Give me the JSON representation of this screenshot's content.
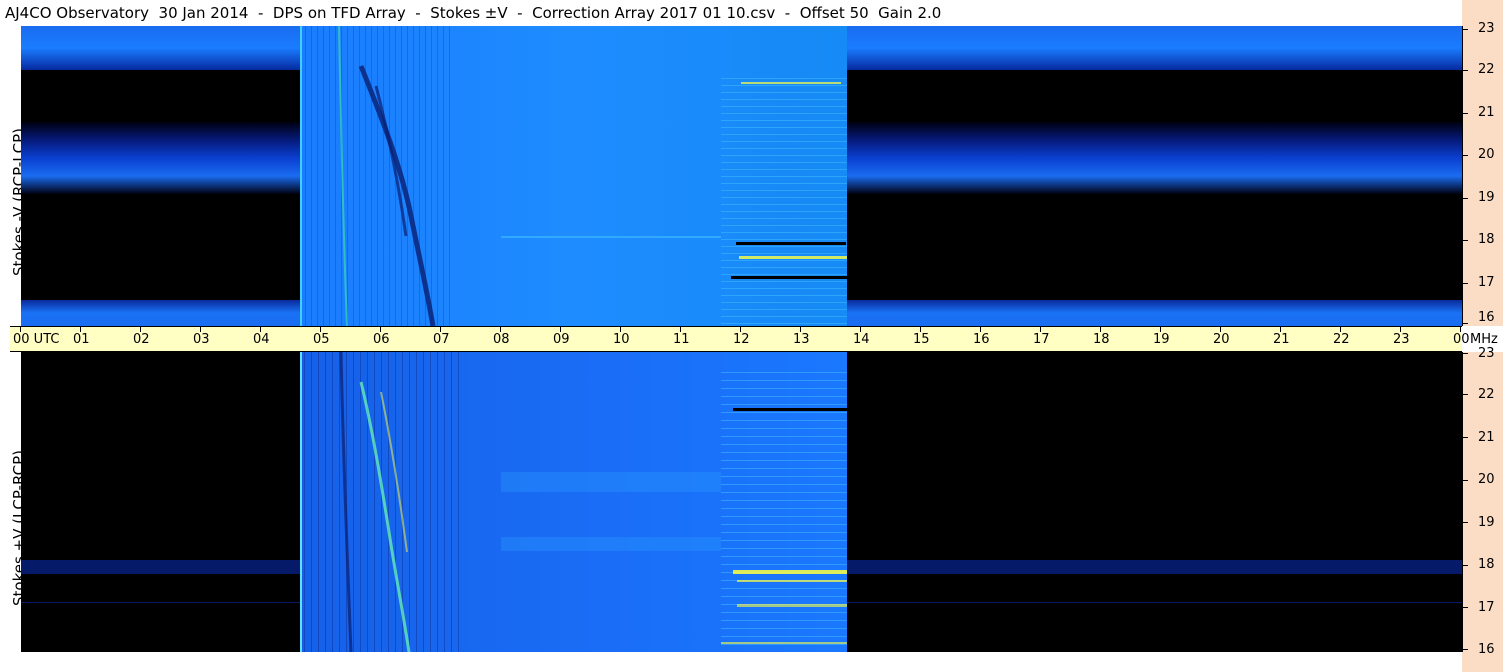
{
  "title": "AJ4CO Observatory  30 Jan 2014  -  DPS on TFD Array  -  Stokes ±V  -  Correction Array 2017 01 10.csv  -  Offset 50  Gain 2.0",
  "upper_panel_label": "Stokes -V (RCP-LCP)",
  "lower_panel_label": "Stokes +V (LCP-RCP)",
  "time_axis": {
    "labels": [
      "00 UTC",
      "01",
      "02",
      "03",
      "04",
      "05",
      "06",
      "07",
      "08",
      "09",
      "10",
      "11",
      "12",
      "13",
      "14",
      "15",
      "16",
      "17",
      "18",
      "19",
      "20",
      "21",
      "22",
      "23",
      "00"
    ],
    "unit_label": "MHz"
  },
  "freq_axis": {
    "labels": [
      "23",
      "22",
      "21",
      "20",
      "19",
      "18",
      "17",
      "16"
    ]
  },
  "colors": {
    "background": "#000000",
    "signal_blue": "#1a7cff",
    "deep_blue": "#0a2a9c",
    "burst_yellow": "#ffff40",
    "time_axis_bg": "#ffffc4",
    "freq_axis_bg": "#fbdcc4"
  }
}
